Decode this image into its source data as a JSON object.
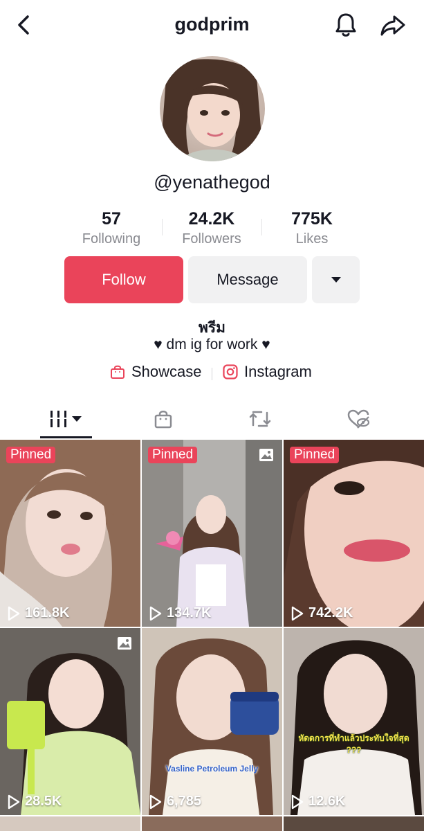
{
  "header": {
    "title": "godprim"
  },
  "profile": {
    "username": "@yenathegod"
  },
  "stats": [
    {
      "value": "57",
      "label": "Following"
    },
    {
      "value": "24.2K",
      "label": "Followers"
    },
    {
      "value": "775K",
      "label": "Likes"
    }
  ],
  "actions": {
    "follow": "Follow",
    "message": "Message"
  },
  "bio": {
    "name": "พรีม",
    "line": "♥ dm ig for work ♥"
  },
  "links": {
    "showcase": "Showcase",
    "instagram": "Instagram"
  },
  "colors": {
    "accent": "#ea445a",
    "text": "#161823",
    "muted": "#8a8b91",
    "button_bg": "#f1f1f2"
  },
  "videos": [
    {
      "pinned": "Pinned",
      "views": "161.8K"
    },
    {
      "pinned": "Pinned",
      "views": "134.7K"
    },
    {
      "pinned": "Pinned",
      "views": "742.2K"
    },
    {
      "views": "28.5K"
    },
    {
      "views": "6,785",
      "caption": "Vasline Petroleum Jelly"
    },
    {
      "views": "12.6K",
      "caption": "หัดดการที่ทำแล้วประทับใจที่สุด ???"
    }
  ]
}
